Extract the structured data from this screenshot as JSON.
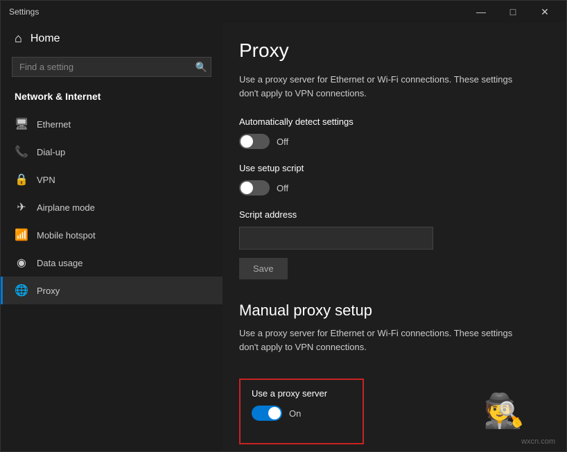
{
  "window": {
    "title": "Settings",
    "controls": {
      "minimize": "—",
      "maximize": "□",
      "close": "✕"
    }
  },
  "sidebar": {
    "home_label": "Home",
    "search_placeholder": "Find a setting",
    "section_title": "Network & Internet",
    "items": [
      {
        "id": "ethernet",
        "label": "Ethernet",
        "icon": "🖥"
      },
      {
        "id": "dialup",
        "label": "Dial-up",
        "icon": "📞"
      },
      {
        "id": "vpn",
        "label": "VPN",
        "icon": "🔒"
      },
      {
        "id": "airplane",
        "label": "Airplane mode",
        "icon": "✈"
      },
      {
        "id": "hotspot",
        "label": "Mobile hotspot",
        "icon": "📶"
      },
      {
        "id": "data",
        "label": "Data usage",
        "icon": "◉"
      },
      {
        "id": "proxy",
        "label": "Proxy",
        "icon": "🌐",
        "active": true
      }
    ]
  },
  "proxy_page": {
    "title": "Proxy",
    "automatic_section": {
      "description": "Use a proxy server for Ethernet or Wi-Fi connections. These settings don't apply to VPN connections.",
      "detect_label": "Automatically detect settings",
      "detect_status": "Off",
      "detect_on": false,
      "setup_label": "Use setup script",
      "setup_status": "Off",
      "setup_on": false,
      "script_address_label": "Script address",
      "script_address_value": "",
      "save_label": "Save"
    },
    "manual_section": {
      "heading": "Manual proxy setup",
      "description": "Use a proxy server for Ethernet or Wi-Fi connections. These settings don't apply to VPN connections.",
      "proxy_server_label": "Use a proxy server",
      "proxy_server_status": "On",
      "proxy_server_on": true
    }
  },
  "watermark": "wxcn.com"
}
